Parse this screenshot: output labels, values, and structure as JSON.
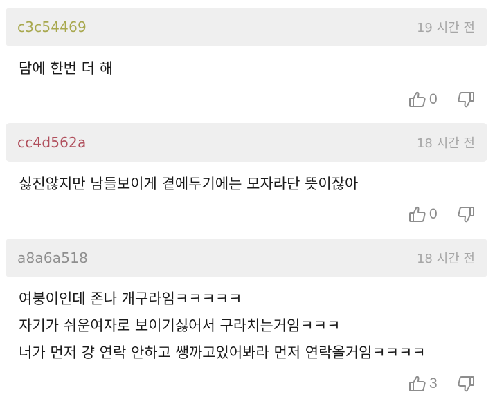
{
  "comments": [
    {
      "username": "c3c54469",
      "username_color": "#a8a84e",
      "timestamp": "19 시간 전",
      "lines": [
        "담에 한번 더 해"
      ],
      "likes": "0",
      "thumbs_up_icon": "thumbs-up-icon",
      "thumbs_down_icon": "thumbs-down-icon"
    },
    {
      "username": "cc4d562a",
      "username_color": "#b04f5c",
      "timestamp": "18 시간 전",
      "lines": [
        "싫진않지만 남들보이게 곁에두기에는 모자라단 뜻이잖아"
      ],
      "likes": "0",
      "thumbs_up_icon": "thumbs-up-icon",
      "thumbs_down_icon": "thumbs-down-icon"
    },
    {
      "username": "a8a6a518",
      "username_color": "#8f8f8f",
      "timestamp": "18 시간 전",
      "lines": [
        "여붕이인데 존나 개구라임ㅋㅋㅋㅋㅋ",
        "자기가 쉬운여자로 보이기싫어서 구라치는거임ㅋㅋㅋ",
        "너가 먼저 걍 연락 안하고 쌩까고있어봐라 먼저 연락올거임ㅋㅋㅋㅋ"
      ],
      "likes": "3",
      "thumbs_up_icon": "thumbs-up-icon",
      "thumbs_down_icon": "thumbs-down-icon"
    }
  ]
}
